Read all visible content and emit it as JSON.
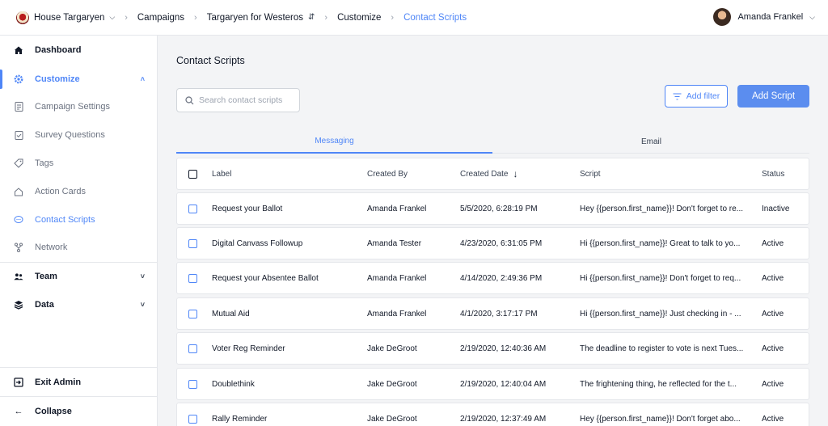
{
  "breadcrumbs": {
    "org": "House Targaryen",
    "campaigns": "Campaigns",
    "campaign": "Targaryen for Westeros",
    "customize": "Customize",
    "current": "Contact Scripts"
  },
  "user": {
    "name": "Amanda Frankel"
  },
  "sidebar": {
    "dashboard": "Dashboard",
    "customize": "Customize",
    "campaign_settings": "Campaign Settings",
    "survey_questions": "Survey Questions",
    "tags": "Tags",
    "action_cards": "Action Cards",
    "contact_scripts": "Contact Scripts",
    "network": "Network",
    "team": "Team",
    "data": "Data",
    "exit_admin": "Exit Admin",
    "collapse": "Collapse"
  },
  "page": {
    "title": "Contact Scripts",
    "search_placeholder": "Search contact scripts",
    "add_filter": "Add filter",
    "add_script": "Add Script"
  },
  "tabs": [
    "Messaging",
    "Email"
  ],
  "table": {
    "columns": {
      "label": "Label",
      "created_by": "Created By",
      "created_date": "Created Date",
      "script": "Script",
      "status": "Status"
    },
    "rows": [
      {
        "label": "Request your Ballot",
        "created_by": "Amanda Frankel",
        "created_date": "5/5/2020, 6:28:19 PM",
        "script": "Hey {{person.first_name}}! Don't forget to re...",
        "status": "Inactive"
      },
      {
        "label": "Digital Canvass Followup",
        "created_by": "Amanda Tester",
        "created_date": "4/23/2020, 6:31:05 PM",
        "script": "Hi {{person.first_name}}! Great to talk to yo...",
        "status": "Active"
      },
      {
        "label": "Request your Absentee Ballot",
        "created_by": "Amanda Frankel",
        "created_date": "4/14/2020, 2:49:36 PM",
        "script": "Hi {{person.first_name}}! Don't forget to req...",
        "status": "Active"
      },
      {
        "label": "Mutual Aid",
        "created_by": "Amanda Frankel",
        "created_date": "4/1/2020, 3:17:17 PM",
        "script": "Hi {{person.first_name}}! Just checking in - ...",
        "status": "Active"
      },
      {
        "label": "Voter Reg Reminder",
        "created_by": "Jake DeGroot",
        "created_date": "2/19/2020, 12:40:36 AM",
        "script": "The deadline to register to vote is next Tues...",
        "status": "Active"
      },
      {
        "label": "Doublethink",
        "created_by": "Jake DeGroot",
        "created_date": "2/19/2020, 12:40:04 AM",
        "script": "The frightening thing, he reflected for the t...",
        "status": "Active"
      },
      {
        "label": "Rally Reminder",
        "created_by": "Jake DeGroot",
        "created_date": "2/19/2020, 12:37:49 AM",
        "script": "Hey {{person.first_name}}! Don't forget abo...",
        "status": "Active"
      }
    ]
  }
}
